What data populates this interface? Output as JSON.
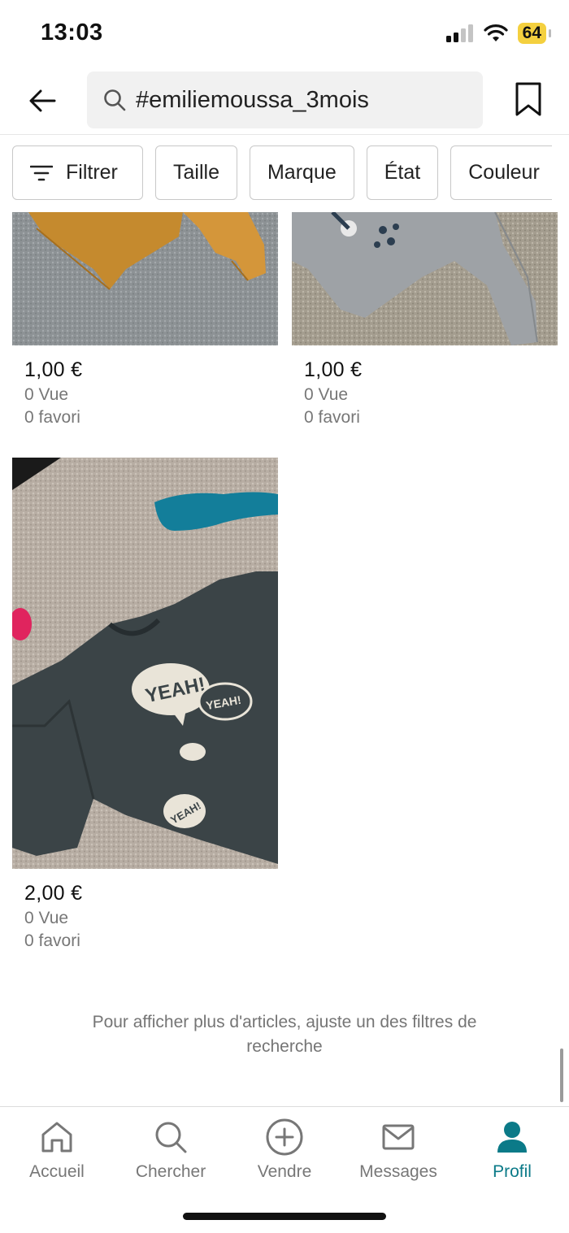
{
  "status_bar": {
    "time": "13:03",
    "battery": "64"
  },
  "search": {
    "query": "#emiliemoussa_3mois"
  },
  "filters": [
    "Filtrer",
    "Taille",
    "Marque",
    "État",
    "Couleur"
  ],
  "items": [
    {
      "price": "1,00 €",
      "views": "0 Vue",
      "favorites": "0 favori"
    },
    {
      "price": "1,00 €",
      "views": "0 Vue",
      "favorites": "0 favori"
    },
    {
      "price": "2,00 €",
      "views": "0 Vue",
      "favorites": "0 favori"
    }
  ],
  "end_message": "Pour afficher plus d'articles, ajuste un des filtres de recherche",
  "tabs": [
    {
      "label": "Accueil",
      "icon": "home-icon"
    },
    {
      "label": "Chercher",
      "icon": "search-icon"
    },
    {
      "label": "Vendre",
      "icon": "plus-circle-icon"
    },
    {
      "label": "Messages",
      "icon": "mail-icon"
    },
    {
      "label": "Profil",
      "icon": "profile-icon",
      "active": true
    }
  ],
  "colors": {
    "accent": "#0b7a88",
    "muted_text": "#777777"
  }
}
